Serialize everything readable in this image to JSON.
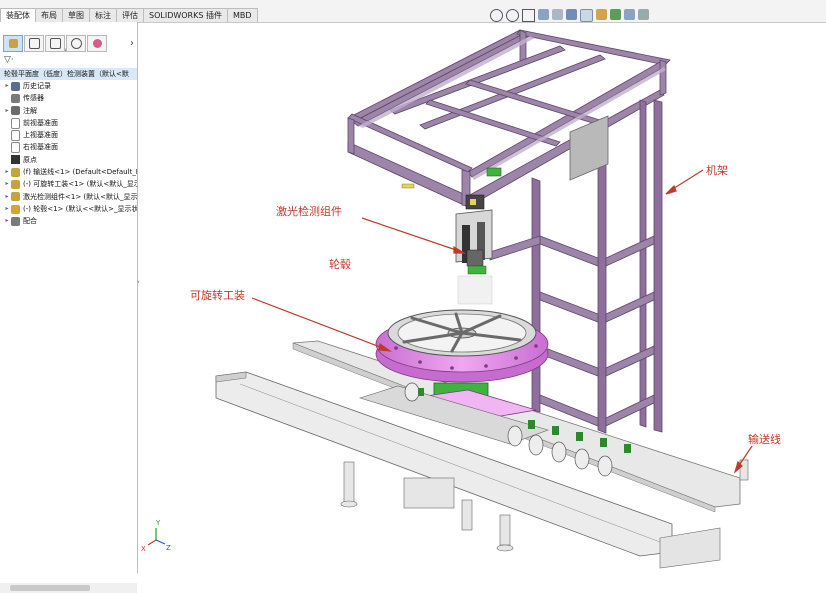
{
  "tabs": [
    "装配体",
    "布局",
    "草图",
    "标注",
    "评估",
    "SOLIDWORKS 插件",
    "MBD"
  ],
  "panel": {
    "more_chevron": "›",
    "root_label": "轮毂平面度（低度）检测装置（默认<默",
    "items": [
      {
        "label": "历史记录",
        "icon": "history-icon",
        "color": "#5a6f8a",
        "expand": "▸"
      },
      {
        "label": "传感器",
        "icon": "sensor-icon",
        "color": "#7a7a7a",
        "expand": ""
      },
      {
        "label": "注解",
        "icon": "annotation-icon",
        "color": "#6b6b6b",
        "expand": "▸"
      },
      {
        "label": "前视基准面",
        "icon": "plane-icon",
        "color": "#8a8a8a",
        "expand": ""
      },
      {
        "label": "上视基准面",
        "icon": "plane-icon",
        "color": "#8a8a8a",
        "expand": ""
      },
      {
        "label": "右视基准面",
        "icon": "plane-icon",
        "color": "#8a8a8a",
        "expand": ""
      },
      {
        "label": "原点",
        "icon": "origin-icon",
        "color": "#333333",
        "expand": ""
      },
      {
        "label": "(f) 输送线<1> (Default<Default_D",
        "icon": "assembly-icon",
        "color": "#c8a23a",
        "expand": "▸"
      },
      {
        "label": "(-) 可旋转工装<1> (默认<默认_显示",
        "icon": "assembly-icon",
        "color": "#c8a23a",
        "expand": "▸"
      },
      {
        "label": "激光检测组件<1> (默认<默认_显示",
        "icon": "assembly-icon",
        "color": "#c8a23a",
        "expand": "▸"
      },
      {
        "label": "(-) 轮毂<1> (默认<<默认>_显示状",
        "icon": "part-icon",
        "color": "#d4a534",
        "expand": "▸"
      },
      {
        "label": "配合",
        "icon": "mates-icon",
        "color": "#7a7a7a",
        "expand": "▸"
      }
    ]
  },
  "annotations": {
    "frame": "机架",
    "laser": "激光检测组件",
    "hub": "轮毂",
    "fixture": "可旋转工装",
    "conveyor": "输送线"
  },
  "triad": {
    "x": "X",
    "y": "Y",
    "z": "Z"
  },
  "colors": {
    "frame": "#8e6f9c",
    "frame_dark": "#5d4868",
    "fixture": "#e58ee8",
    "green": "#3fb23f",
    "label_red": "#c0392b",
    "conveyor": "#ececec"
  }
}
